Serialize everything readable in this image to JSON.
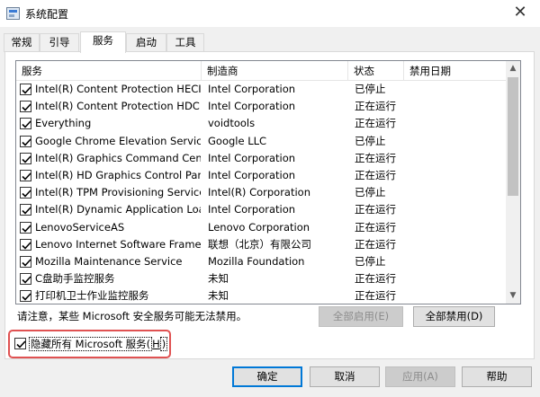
{
  "window": {
    "title": "系统配置",
    "close_glyph": "✕"
  },
  "tabs": [
    {
      "label": "常规",
      "active": false
    },
    {
      "label": "引导",
      "active": false
    },
    {
      "label": "服务",
      "active": true
    },
    {
      "label": "启动",
      "active": false
    },
    {
      "label": "工具",
      "active": false
    }
  ],
  "services": {
    "columns": [
      "服务",
      "制造商",
      "状态",
      "禁用日期"
    ],
    "rows": [
      {
        "checked": true,
        "name": "Intel(R) Content Protection HECI ...",
        "manufacturer": "Intel Corporation",
        "status": "已停止"
      },
      {
        "checked": true,
        "name": "Intel(R) Content Protection HDCP...",
        "manufacturer": "Intel Corporation",
        "status": "正在运行"
      },
      {
        "checked": true,
        "name": "Everything",
        "manufacturer": "voidtools",
        "status": "正在运行"
      },
      {
        "checked": true,
        "name": "Google Chrome Elevation Servic...",
        "manufacturer": "Google LLC",
        "status": "已停止"
      },
      {
        "checked": true,
        "name": "Intel(R) Graphics Command Cent...",
        "manufacturer": "Intel Corporation",
        "status": "正在运行"
      },
      {
        "checked": true,
        "name": "Intel(R) HD Graphics Control Pan...",
        "manufacturer": "Intel Corporation",
        "status": "正在运行"
      },
      {
        "checked": true,
        "name": "Intel(R) TPM Provisioning Service",
        "manufacturer": "Intel(R) Corporation",
        "status": "已停止"
      },
      {
        "checked": true,
        "name": "Intel(R) Dynamic Application Loa...",
        "manufacturer": "Intel Corporation",
        "status": "正在运行"
      },
      {
        "checked": true,
        "name": "LenovoServiceAS",
        "manufacturer": "Lenovo Corporation",
        "status": "正在运行"
      },
      {
        "checked": true,
        "name": "Lenovo Internet Software Frame...",
        "manufacturer": "联想（北京）有限公司",
        "status": "正在运行"
      },
      {
        "checked": true,
        "name": "Mozilla Maintenance Service",
        "manufacturer": "Mozilla Foundation",
        "status": "已停止"
      },
      {
        "checked": true,
        "name": "C盘助手监控服务",
        "manufacturer": "未知",
        "status": "正在运行"
      },
      {
        "checked": true,
        "name": "打印机卫士作业监控服务",
        "manufacturer": "未知",
        "status": "正在运行"
      }
    ]
  },
  "note": "请注意，某些 Microsoft 安全服务可能无法禁用。",
  "buttons": {
    "enable_all": "全部启用(E)",
    "disable_all": "全部禁用(D)",
    "ok": "确定",
    "cancel": "取消",
    "apply": "应用(A)",
    "help": "帮助"
  },
  "hide_ms": {
    "checked": true,
    "label_prefix": "隐藏所有 Microsoft 服务(",
    "label_key": "H",
    "label_suffix": ")"
  },
  "colors": {
    "highlight_border": "#e05252",
    "default_button_border": "#0078d7"
  }
}
